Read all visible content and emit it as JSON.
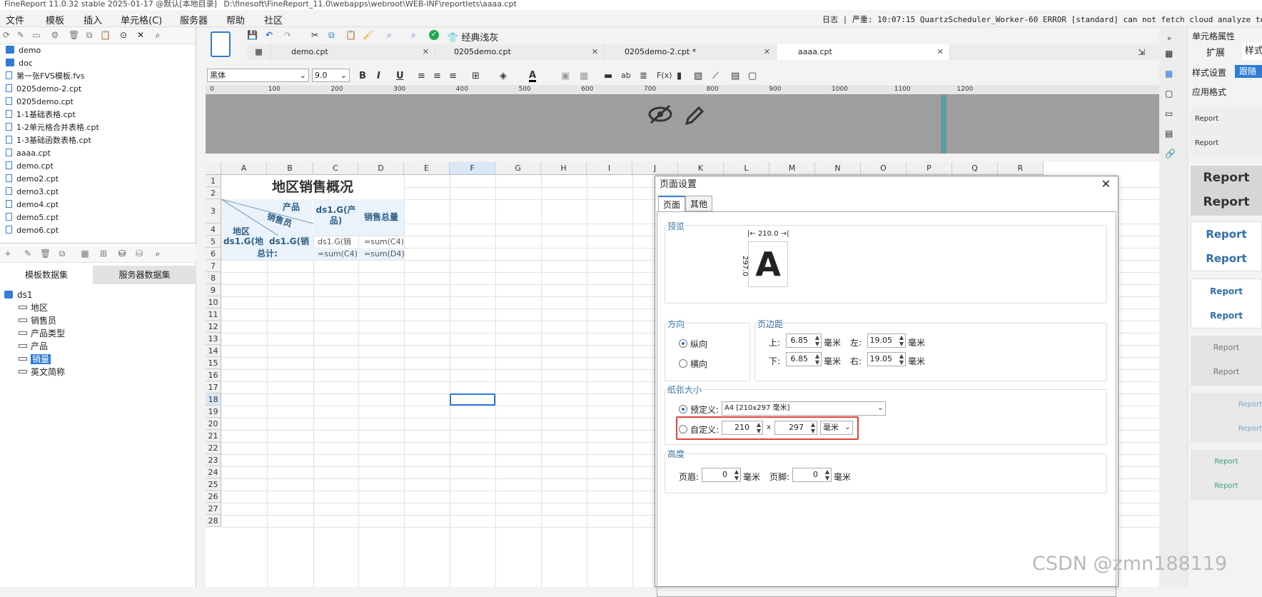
{
  "window": {
    "title": "FineReport 11.0.32 stable 2025-01-17 @默认[本地目录]",
    "path": "D:\\finesoft\\FineReport_11.0\\webapps\\webroot\\WEB-INF\\reportlets\\aaaa.cpt"
  },
  "menu": [
    "文件",
    "模板",
    "插入",
    "单元格(C)",
    "服务器",
    "帮助",
    "社区"
  ],
  "log": {
    "label": "日志",
    "severity": "严重:",
    "message": "10:07:15 QuartzScheduler_Worker-60 ERROR [standard] can not fetch cloud analyze token."
  },
  "template_tree": [
    "demo",
    "doc",
    "第一张FVS模板.fvs",
    "0205demo-2.cpt",
    "0205demo.cpt",
    "1-1基础表格.cpt",
    "1-2单元格合并表格.cpt",
    "1-3基础函数表格.cpt",
    "aaaa.cpt",
    "demo.cpt",
    "demo2.cpt",
    "demo3.cpt",
    "demo4.cpt",
    "demo5.cpt",
    "demo6.cpt"
  ],
  "dataset_tabs": [
    "模板数据集",
    "服务器数据集"
  ],
  "dataset": {
    "name": "ds1",
    "fields": [
      "地区",
      "销售员",
      "产品类型",
      "产品",
      "销量",
      "英文简称"
    ],
    "selected": "销量"
  },
  "toolbar": {
    "theme_label": "经典浅灰"
  },
  "tabs": [
    "demo.cpt",
    "0205demo.cpt",
    "0205demo-2.cpt *",
    "aaaa.cpt"
  ],
  "format": {
    "font": "黑体",
    "size": "9.0"
  },
  "ruler_ticks": [
    "0",
    "100",
    "200",
    "300",
    "400",
    "500",
    "600",
    "700",
    "800",
    "900",
    "1000",
    "1100",
    "1200"
  ],
  "columns": [
    "A",
    "B",
    "C",
    "D",
    "E",
    "F",
    "G",
    "H",
    "I",
    "J",
    "K",
    "L",
    "M",
    "N",
    "O",
    "P",
    "Q",
    "R"
  ],
  "rows": [
    "1",
    "2",
    "3",
    "4",
    "5",
    "6",
    "7",
    "8",
    "9",
    "10",
    "11",
    "12",
    "13",
    "14",
    "15",
    "16",
    "17",
    "18",
    "19",
    "20",
    "21",
    "22",
    "23",
    "24",
    "25",
    "26",
    "27",
    "28"
  ],
  "sheet": {
    "title": "地区销售概况",
    "diag_product": "产品",
    "diag_sales": "销售员",
    "diag_region": "地区",
    "c3": "ds1.G(产品)",
    "d3": "销售总量",
    "a4": "ds1.G(地",
    "b4": "ds1.G(销",
    "c4": "ds1.G(销",
    "d4": "=sum(C4)",
    "total_label": "总计:",
    "c5": "=sum(C4)",
    "d5": "=sum(D4)"
  },
  "dialog": {
    "title": "页面设置",
    "tabs": [
      "页面",
      "其他"
    ],
    "preview_label": "预览",
    "preview_width": "210.0",
    "preview_height": "297.0",
    "preview_letter": "A",
    "orientation_label": "方向",
    "portrait": "纵向",
    "landscape": "横向",
    "margin_label": "页边距",
    "top_label": "上:",
    "bottom_label": "下:",
    "left_label": "左:",
    "right_label": "右:",
    "top": "6.85",
    "bottom": "6.85",
    "left": "19.05",
    "right": "19.05",
    "unit": "毫米",
    "paper_label": "纸张大小",
    "predefined_label": "预定义:",
    "predefined_value": "A4 [210x297 毫米]",
    "custom_label": "自定义:",
    "custom_width": "210",
    "custom_height": "297",
    "times": "x",
    "height_label": "高度",
    "header_label": "页眉:",
    "footer_label": "页脚:",
    "header_value": "0",
    "footer_value": "0"
  },
  "right_panel": {
    "title": "单元格属性",
    "tabs": [
      "扩展",
      "样式"
    ],
    "style_setting": "样式设置",
    "follow": "跟随",
    "apply_style": "应用格式",
    "sample": "Report"
  },
  "watermark": "CSDN @zmn188119"
}
